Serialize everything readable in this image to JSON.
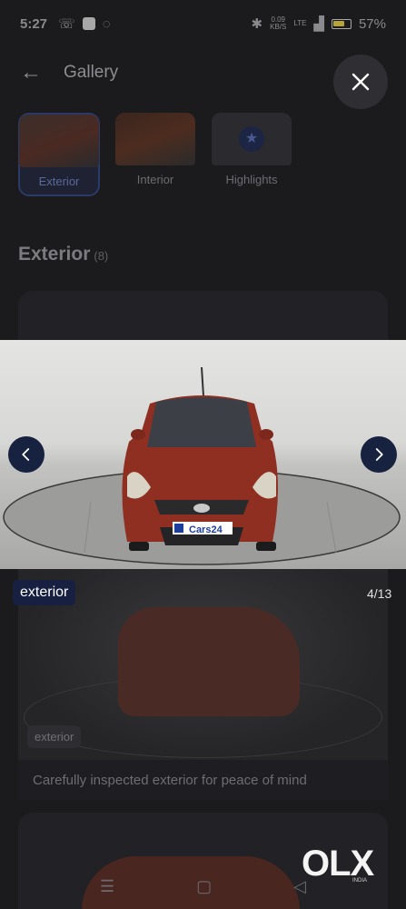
{
  "status_bar": {
    "time": "5:27",
    "net_speed_top": "0.09",
    "net_speed_unit": "KB/S",
    "lte_label": "LTE",
    "battery": "57%"
  },
  "header": {
    "title": "Gallery"
  },
  "categories": [
    {
      "label": "Exterior",
      "active": true
    },
    {
      "label": "Interior",
      "active": false
    },
    {
      "label": "Highlights",
      "active": false
    }
  ],
  "section": {
    "title": "Exterior",
    "count": "(8)"
  },
  "viewer": {
    "tag": "exterior",
    "counter": "4/13",
    "plate_text": "Cars24"
  },
  "next_card": {
    "tag": "exterior",
    "caption": "Carefully inspected exterior for peace of mind"
  },
  "watermark": {
    "logo": "OLX",
    "sub": "INDIA"
  },
  "colors": {
    "accent_navy": "#16223f",
    "car_red": "#8f2f22",
    "backdrop": "#1b1b1e"
  }
}
